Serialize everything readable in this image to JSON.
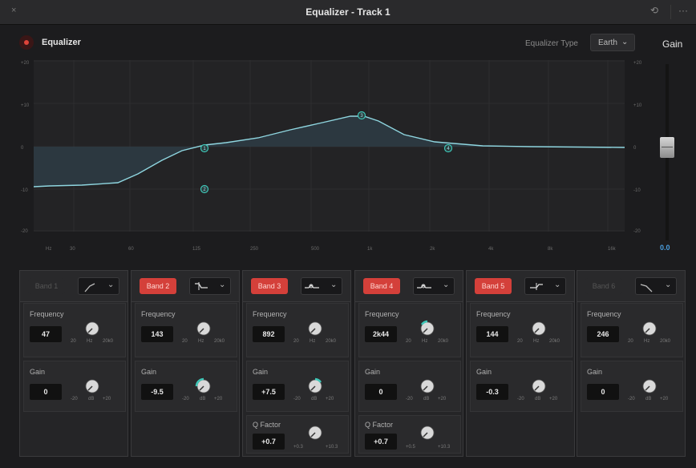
{
  "window": {
    "title": "Equalizer - Track 1",
    "menu_glyph": "···"
  },
  "header": {
    "eq_label": "Equalizer",
    "type_label": "Equalizer Type",
    "type_value": "Earth",
    "gain_label": "Gain",
    "gain_value": "0.0"
  },
  "graph": {
    "y_ticks": [
      "+20",
      "+10",
      "0",
      "-10",
      "-20"
    ],
    "x_ticks": [
      "Hz",
      "30",
      "60",
      "125",
      "250",
      "500",
      "1k",
      "2k",
      "4k",
      "8k",
      "16k"
    ]
  },
  "colors": {
    "curve": "#8fd6e0",
    "band_on": "#d4403a",
    "knob_arc": "#3ec7b8"
  },
  "bands": [
    {
      "label": "Band 1",
      "enabled": false,
      "shape_icon": "low-cut-icon",
      "freq_label": "Frequency",
      "freq_value": "47",
      "freq_range": [
        "20",
        "Hz",
        "20k0"
      ],
      "gain_label": "Gain",
      "gain_value": "0",
      "gain_range": [
        "-20",
        "dB",
        "+20"
      ]
    },
    {
      "label": "Band 2",
      "enabled": true,
      "shape_icon": "low-shelf-icon",
      "freq_label": "Frequency",
      "freq_value": "143",
      "freq_range": [
        "20",
        "Hz",
        "20k0"
      ],
      "gain_label": "Gain",
      "gain_value": "-9.5",
      "gain_range": [
        "-20",
        "dB",
        "+20"
      ]
    },
    {
      "label": "Band 3",
      "enabled": true,
      "shape_icon": "bell-icon",
      "freq_label": "Frequency",
      "freq_value": "892",
      "freq_range": [
        "20",
        "Hz",
        "20k0"
      ],
      "gain_label": "Gain",
      "gain_value": "+7.5",
      "gain_range": [
        "-20",
        "dB",
        "+20"
      ],
      "q_label": "Q Factor",
      "q_value": "+0.7",
      "q_range": [
        "+0.3",
        "+10.3"
      ]
    },
    {
      "label": "Band 4",
      "enabled": true,
      "shape_icon": "bell-icon",
      "freq_label": "Frequency",
      "freq_value": "2k44",
      "freq_range": [
        "20",
        "Hz",
        "20k0"
      ],
      "gain_label": "Gain",
      "gain_value": "0",
      "gain_range": [
        "-20",
        "dB",
        "+20"
      ],
      "q_label": "Q Factor",
      "q_value": "+0.7",
      "q_range": [
        "+0.5",
        "+10.3"
      ]
    },
    {
      "label": "Band 5",
      "enabled": true,
      "shape_icon": "high-shelf-icon",
      "freq_label": "Frequency",
      "freq_value": "144",
      "freq_range": [
        "20",
        "Hz",
        "20k0"
      ],
      "gain_label": "Gain",
      "gain_value": "-0.3",
      "gain_range": [
        "-20",
        "dB",
        "+20"
      ]
    },
    {
      "label": "Band 6",
      "enabled": false,
      "shape_icon": "high-cut-icon",
      "freq_label": "Frequency",
      "freq_value": "246",
      "freq_range": [
        "20",
        "Hz",
        "20k0"
      ],
      "gain_label": "Gain",
      "gain_value": "0",
      "gain_range": [
        "-20",
        "dB",
        "+20"
      ]
    }
  ]
}
